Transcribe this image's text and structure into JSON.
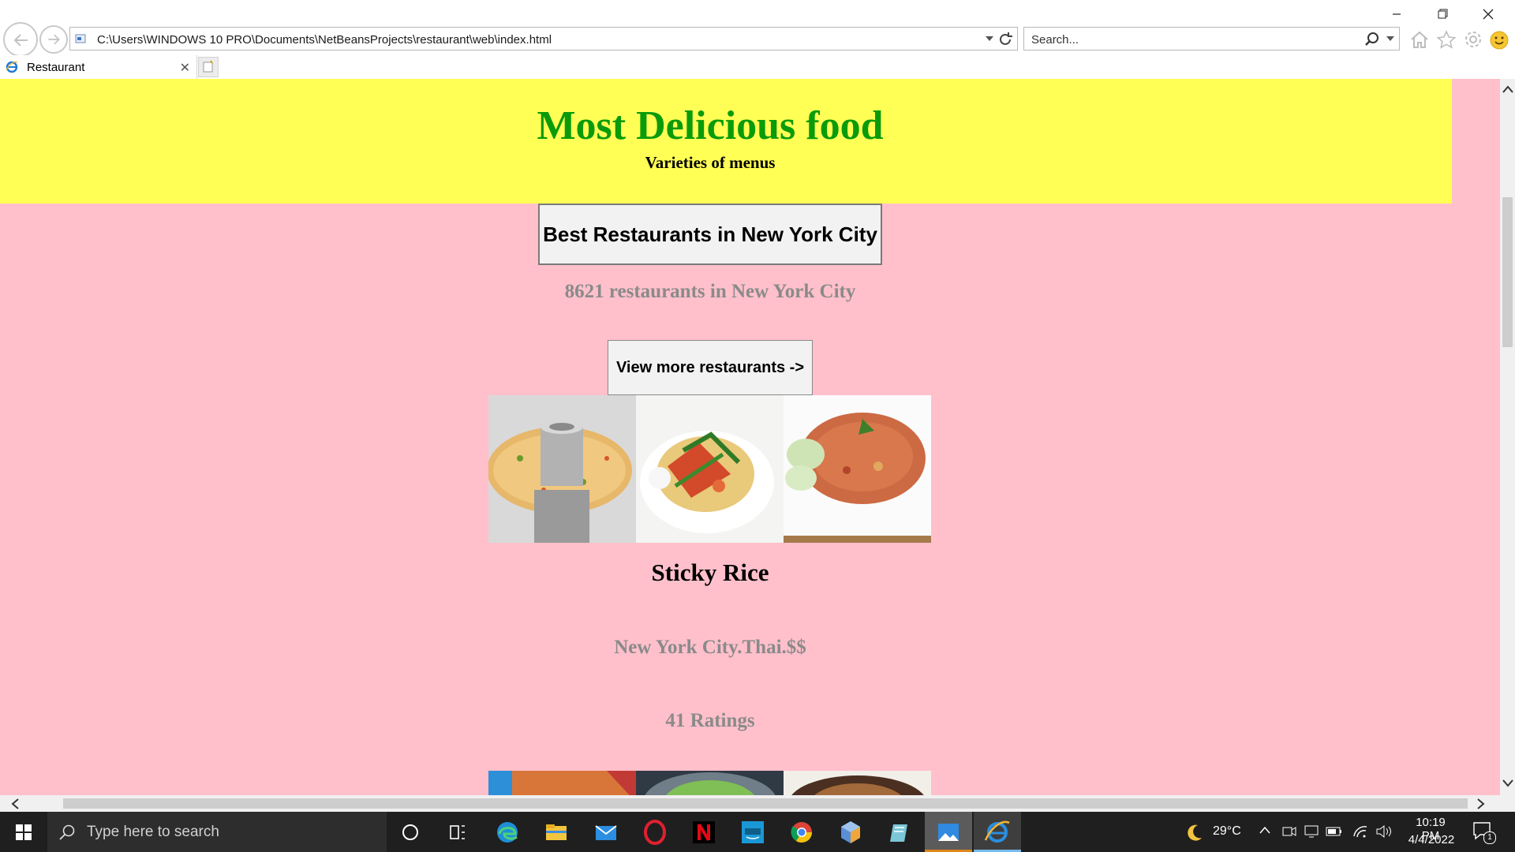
{
  "browser": {
    "address": "C:\\Users\\WINDOWS 10 PRO\\Documents\\NetBeansProjects\\restaurant\\web\\index.html",
    "search_placeholder": "Search...",
    "tab_title": "Restaurant"
  },
  "page": {
    "title": "Most Delicious food",
    "subtitle": "Varieties of menus",
    "best_button": "Best Restaurants in New York City",
    "count_text": "8621 restaurants in New York City",
    "view_more_button": "View more restaurants ->",
    "dish_name": "Sticky Rice",
    "dish_info": "New York City.Thai.$$",
    "ratings": "41 Ratings"
  },
  "colors": {
    "page_bg": "#ffc0cb",
    "header_bg": "#ffff55",
    "title_color": "#0a9b0a"
  },
  "taskbar": {
    "search_placeholder": "Type here to search",
    "temperature": "29°C",
    "time": "10:19 PM",
    "date": "4/4/2022",
    "notification_count": "1"
  }
}
